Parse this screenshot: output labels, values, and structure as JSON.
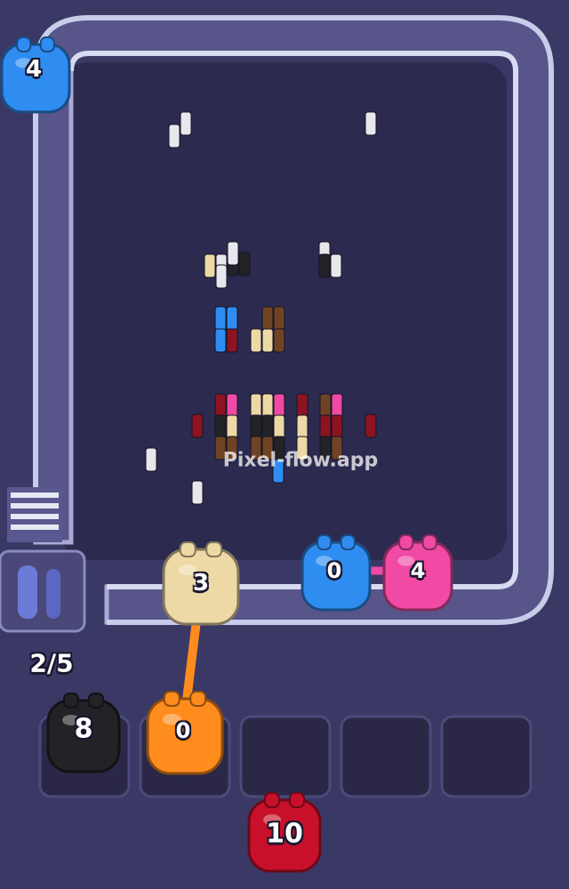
{
  "watermark": "Pixel-flow.app",
  "queue_counter": "2/5",
  "colors": {
    "background": "#3a3864",
    "board": "#2c2a4e",
    "belt": "#6b6a9c",
    "white": "#e8e8ec",
    "black": "#232327",
    "cream": "#ecd9a6",
    "brown": "#6f4424",
    "blue": "#2f8cf0",
    "pink": "#f04aa4",
    "darkred": "#8c1420",
    "orange": "#ff8c1c",
    "red": "#c8102a"
  },
  "shooters": [
    {
      "name": "blue-shooter-top-left",
      "color": "blue",
      "count": "4"
    },
    {
      "name": "cream-shooter-on-belt",
      "color": "cream",
      "count": "3"
    },
    {
      "name": "blue-shooter-on-belt",
      "color": "blue",
      "count": "0"
    },
    {
      "name": "pink-shooter-on-belt",
      "color": "pink",
      "count": "4"
    },
    {
      "name": "black-shooter-slot-1",
      "color": "black",
      "count": "8"
    },
    {
      "name": "orange-shooter-slot-2",
      "color": "orange",
      "count": "0"
    },
    {
      "name": "red-shooter-next",
      "color": "red",
      "count": "10"
    }
  ],
  "empty_slots": 3
}
